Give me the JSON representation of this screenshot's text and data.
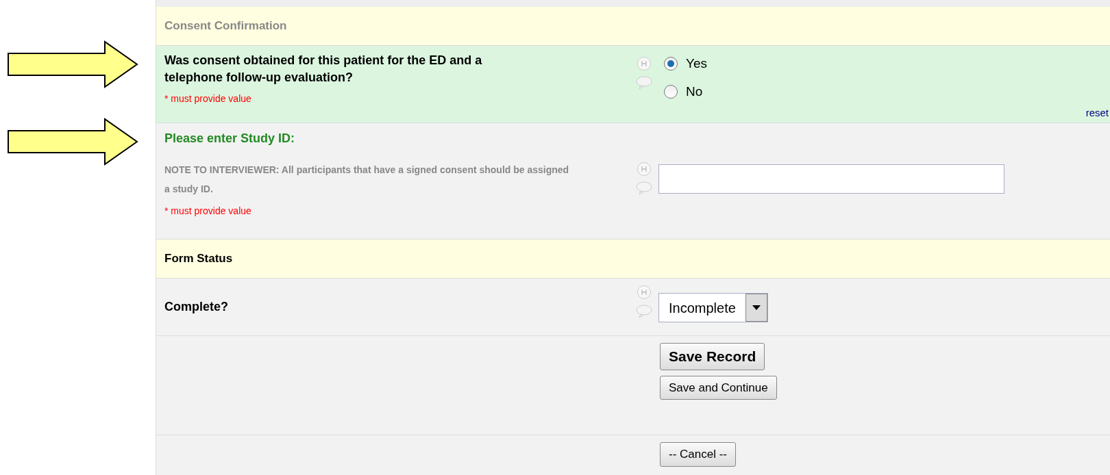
{
  "sections": [
    {
      "kind": "header",
      "title": "Consent Confirmation",
      "muted": true
    },
    {
      "kind": "radio",
      "label": "Was consent obtained for this patient for the ED and a telephone follow-up evaluation?",
      "highlighted": true,
      "required": "* must provide value",
      "options": [
        {
          "label": "Yes",
          "selected": true
        },
        {
          "label": "No",
          "selected": false
        }
      ],
      "reset": "reset",
      "annotated": true
    },
    {
      "kind": "text",
      "label": "Please enter Study ID:",
      "note": "NOTE TO INTERVIEWER: All participants that have a signed consent should be assigned a study ID.",
      "required": "* must provide value",
      "annotated": true
    },
    {
      "kind": "header",
      "title": "Form Status",
      "muted": false
    },
    {
      "kind": "select",
      "label": "Complete?",
      "value": "Incomplete"
    },
    {
      "kind": "buttons",
      "buttons": [
        {
          "label": "Save Record",
          "primary": true
        },
        {
          "label": "Save and Continue",
          "primary": false
        }
      ]
    },
    {
      "kind": "buttons",
      "buttons": [
        {
          "label": "-- Cancel --",
          "primary": false
        }
      ]
    }
  ]
}
